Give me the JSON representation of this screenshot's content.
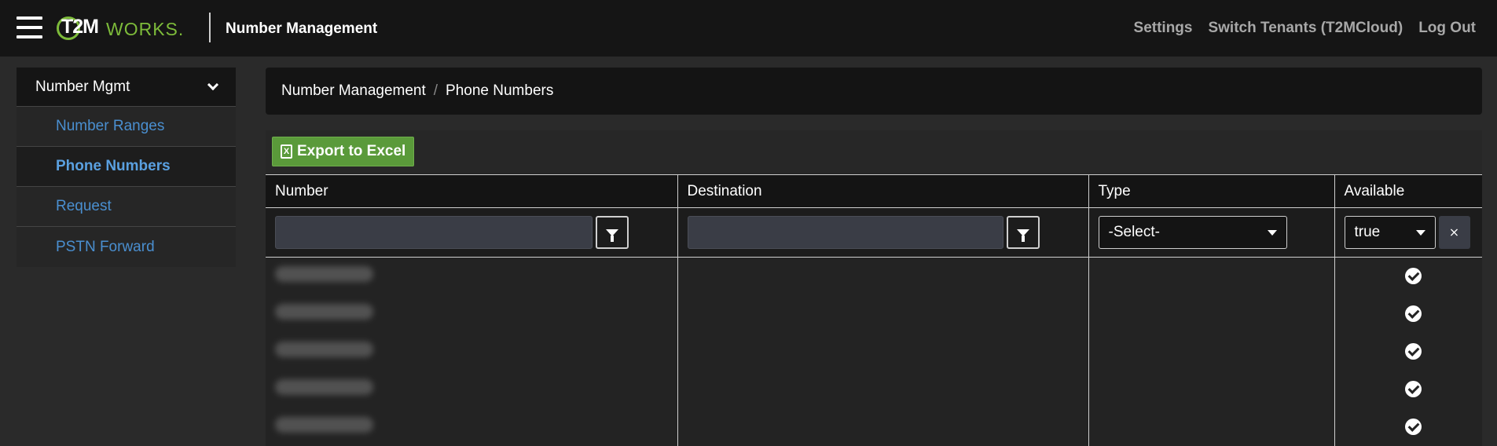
{
  "brand": {
    "logo_t2m": "T2M",
    "logo_works": "WORKS",
    "logo_dot": ".",
    "accent": "#7dbb3a"
  },
  "header": {
    "title": "Number Management"
  },
  "topnav": {
    "settings": "Settings",
    "switch_tenants": "Switch Tenants (T2MCloud)",
    "logout": "Log Out"
  },
  "sidebar": {
    "section_title": "Number Mgmt",
    "items": [
      {
        "label": "Number Ranges",
        "active": false
      },
      {
        "label": "Phone Numbers",
        "active": true
      },
      {
        "label": "Request",
        "active": false
      },
      {
        "label": "PSTN Forward",
        "active": false
      }
    ]
  },
  "breadcrumb": {
    "root": "Number Management",
    "separator": "/",
    "current": "Phone Numbers"
  },
  "toolbar": {
    "export_label": "Export to Excel",
    "export_icon": "excel-icon",
    "export_color": "#5a9a3a"
  },
  "grid": {
    "columns": [
      "Number",
      "Destination",
      "Type",
      "Available"
    ],
    "filters": {
      "number_value": "",
      "destination_value": "",
      "type_value": "-Select-",
      "available_value": "true"
    },
    "rows": [
      {
        "number": "(redacted)",
        "destination": "",
        "type": "",
        "available": true
      },
      {
        "number": "(redacted)",
        "destination": "",
        "type": "",
        "available": true
      },
      {
        "number": "(redacted)",
        "destination": "",
        "type": "",
        "available": true
      },
      {
        "number": "(redacted)",
        "destination": "",
        "type": "",
        "available": true
      },
      {
        "number": "(redacted)",
        "destination": "",
        "type": "",
        "available": true
      }
    ]
  }
}
